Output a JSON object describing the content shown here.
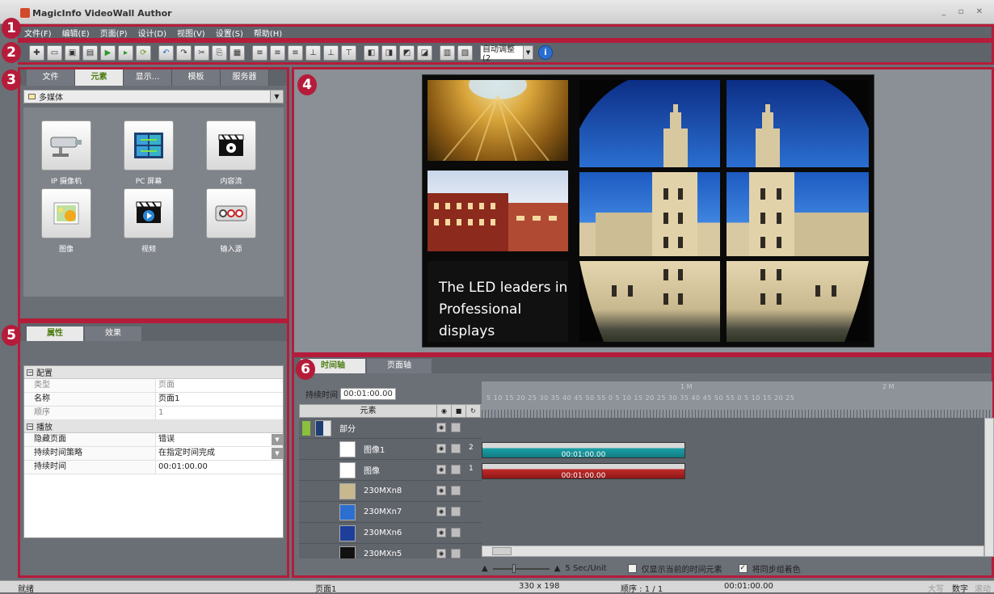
{
  "window": {
    "title": "MagicInfo VideoWall Author"
  },
  "menu": [
    "文件(F)",
    "编辑(E)",
    "页面(P)",
    "设计(D)",
    "视图(V)",
    "设置(S)",
    "帮助(H)"
  ],
  "toolbar": {
    "zoom_value": "自动调整(2"
  },
  "badges": [
    "1",
    "2",
    "3",
    "4",
    "5",
    "6"
  ],
  "left_tabs": [
    "文件",
    "元素",
    "显示...",
    "模板",
    "服务器"
  ],
  "media_filter": "多媒体",
  "media_items": [
    "IP 摄像机",
    "PC 屏幕",
    "内容流",
    "图像",
    "视频",
    "输入源"
  ],
  "prop_tabs": [
    "属性",
    "效果"
  ],
  "properties": {
    "group_config": "配置",
    "config_rows": [
      {
        "k": "类型",
        "v": "页面"
      },
      {
        "k": "名称",
        "v": "页面1"
      },
      {
        "k": "顺序",
        "v": "1"
      }
    ],
    "group_play": "播放",
    "play_rows": [
      {
        "k": "隐藏页面",
        "v": "错误"
      },
      {
        "k": "持续时间策略",
        "v": "在指定时间完成"
      },
      {
        "k": "持续时间",
        "v": "00:01:00.00"
      }
    ]
  },
  "canvas_text": [
    "The LED leaders in",
    "Professional displays"
  ],
  "timeline": {
    "tabs": [
      "时间轴",
      "页面轴"
    ],
    "duration_label": "持续时间",
    "duration_value": "00:01:00.00",
    "col_element": "元素",
    "ruler_text": "5   10   15   20   25   30   35   40   45   50   55   0    5   10   15   20   25   30   35   40   45   50   55   0    5   10   15   20   25",
    "ruler_markers": [
      "1 M",
      "2 M"
    ],
    "rows": [
      {
        "name": "部分",
        "order": ""
      },
      {
        "name": "图像1",
        "order": "2"
      },
      {
        "name": "图像",
        "order": "1"
      },
      {
        "name": "230MXn8",
        "order": ""
      },
      {
        "name": "230MXn7",
        "order": ""
      },
      {
        "name": "230MXn6",
        "order": ""
      },
      {
        "name": "230MXn5",
        "order": ""
      }
    ],
    "bar1_label": "00:01:00.00",
    "bar2_label": "00:01:00.00",
    "unit_label": "5 Sec/Unit",
    "opt1": "仅显示当前的时间元素",
    "opt2": "将同步组着色"
  },
  "status": {
    "ready": "就绪",
    "page": "页面1",
    "size": "330 x 198",
    "order": "顺序 : 1 / 1",
    "time": "00:01:00.00",
    "caps": "大写",
    "num": "数字",
    "scroll": "滚动"
  }
}
